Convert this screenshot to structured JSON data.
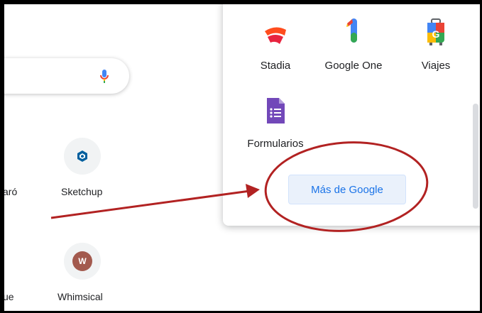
{
  "shortcuts": [
    {
      "label": "aró",
      "icon": "partial-icon"
    },
    {
      "label": "Sketchup",
      "icon": "sketchup-icon"
    },
    {
      "label": "ue",
      "icon": "partial-icon"
    },
    {
      "label": "Whimsical",
      "icon": "whimsical-icon",
      "badge_letter": "W"
    }
  ],
  "apps_panel": {
    "apps": [
      {
        "label": "Stadia",
        "icon": "stadia-icon"
      },
      {
        "label": "Google One",
        "icon": "google-one-icon"
      },
      {
        "label": "Viajes",
        "icon": "viajes-icon"
      },
      {
        "label": "Formularios",
        "icon": "formularios-icon"
      }
    ],
    "more_button": "Más de Google"
  },
  "annotation": {
    "color": "#b22222"
  },
  "colors": {
    "accent": "#1a73e8",
    "forms": "#7248b9",
    "stadia": "#ff4c1d"
  }
}
